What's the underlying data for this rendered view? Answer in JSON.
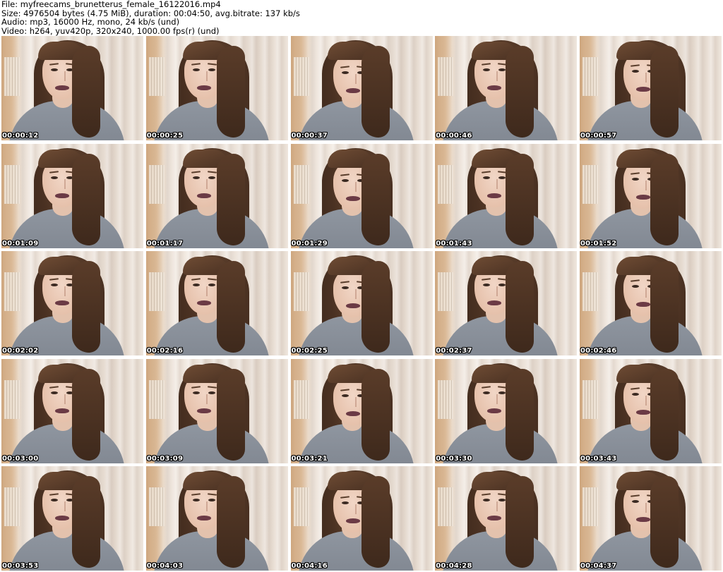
{
  "header": {
    "file_line": "File: myfreecams_brunetterus_female_16122016.mp4",
    "size_line": "Size: 4976504 bytes (4.75 MiB), duration: 00:04:50, avg.bitrate: 137 kb/s",
    "audio_line": "Audio: mp3, 16000 Hz, mono, 24 kb/s (und)",
    "video_line": "Video: h264, yuv420p, 320x240, 1000.00 fps(r) (und)"
  },
  "thumbnails": [
    {
      "timestamp": "00:00:12"
    },
    {
      "timestamp": "00:00:25"
    },
    {
      "timestamp": "00:00:37"
    },
    {
      "timestamp": "00:00:46"
    },
    {
      "timestamp": "00:00:57"
    },
    {
      "timestamp": "00:01:09"
    },
    {
      "timestamp": "00:01:17"
    },
    {
      "timestamp": "00:01:29"
    },
    {
      "timestamp": "00:01:43"
    },
    {
      "timestamp": "00:01:52"
    },
    {
      "timestamp": "00:02:02"
    },
    {
      "timestamp": "00:02:16"
    },
    {
      "timestamp": "00:02:25"
    },
    {
      "timestamp": "00:02:37"
    },
    {
      "timestamp": "00:02:46"
    },
    {
      "timestamp": "00:03:00"
    },
    {
      "timestamp": "00:03:09"
    },
    {
      "timestamp": "00:03:21"
    },
    {
      "timestamp": "00:03:30"
    },
    {
      "timestamp": "00:03:43"
    },
    {
      "timestamp": "00:03:53"
    },
    {
      "timestamp": "00:04:03"
    },
    {
      "timestamp": "00:04:16"
    },
    {
      "timestamp": "00:04:28"
    },
    {
      "timestamp": "00:04:37"
    }
  ]
}
